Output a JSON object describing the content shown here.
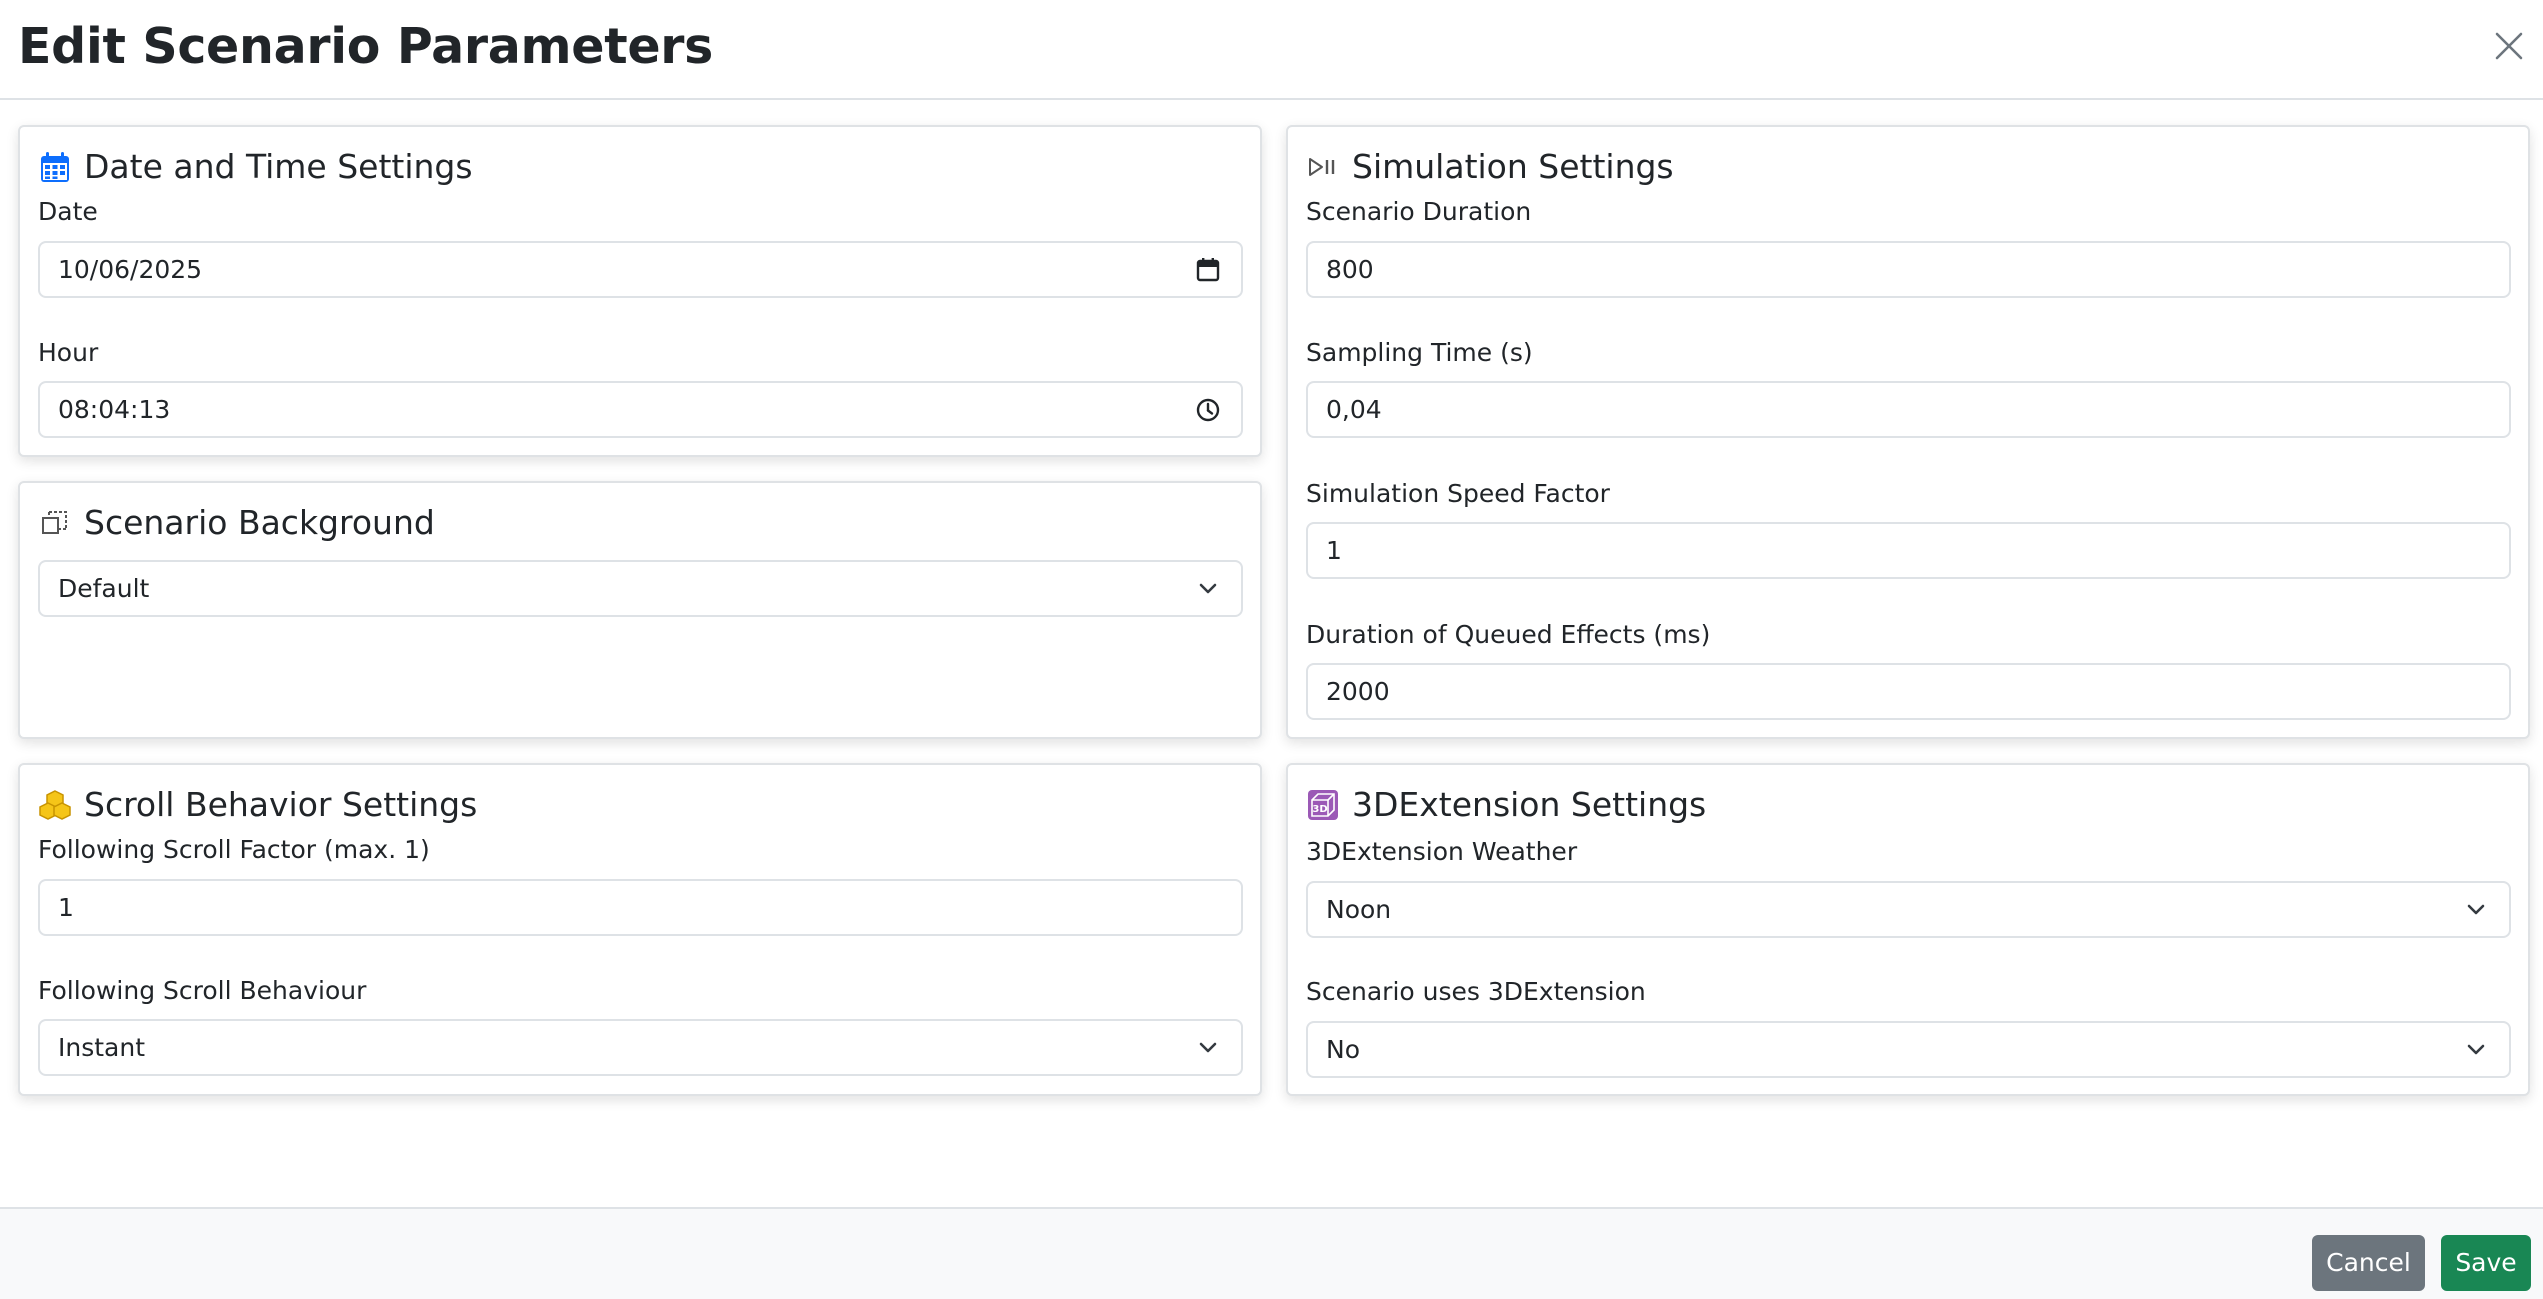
{
  "modal": {
    "title": "Edit Scenario Parameters",
    "cancel_label": "Cancel",
    "save_label": "Save"
  },
  "date_time": {
    "title": "Date and Time Settings",
    "date_label": "Date",
    "date_value": "10/06/2025",
    "hour_label": "Hour",
    "hour_value": "08:04:13"
  },
  "background": {
    "title": "Scenario Background",
    "selected": "Default"
  },
  "scroll": {
    "title": "Scroll Behavior Settings",
    "factor_label": "Following Scroll Factor (max. 1)",
    "factor_value": "1",
    "behaviour_label": "Following Scroll Behaviour",
    "behaviour_selected": "Instant"
  },
  "simulation": {
    "title": "Simulation Settings",
    "duration_label": "Scenario Duration",
    "duration_value": "800",
    "sampling_label": "Sampling Time (s)",
    "sampling_value": "0,04",
    "speed_label": "Simulation Speed Factor",
    "speed_value": "1",
    "queued_label": "Duration of Queued Effects (ms)",
    "queued_value": "2000"
  },
  "extension": {
    "title": "3DExtension Settings",
    "weather_label": "3DExtension Weather",
    "weather_selected": "Noon",
    "uses_label": "Scenario uses 3DExtension",
    "uses_selected": "No"
  },
  "colors": {
    "calendar_icon": "#0d6efd",
    "cubes_icon": "#f5c518",
    "extension_icon": "#9b59b6",
    "cancel_button": "#6c757d",
    "save_button": "#198754"
  }
}
